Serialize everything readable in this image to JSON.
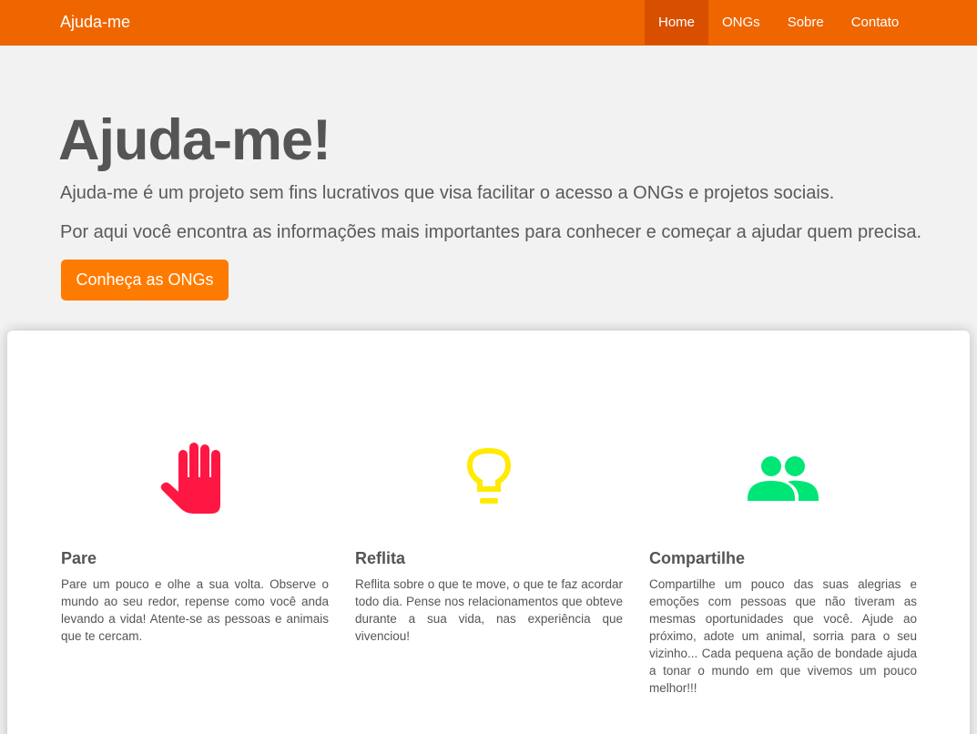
{
  "navbar": {
    "brand": "Ajuda-me",
    "items": [
      {
        "label": "Home",
        "active": true
      },
      {
        "label": "ONGs",
        "active": false
      },
      {
        "label": "Sobre",
        "active": false
      },
      {
        "label": "Contato",
        "active": false
      }
    ],
    "color": "#ef6600"
  },
  "hero": {
    "title": "Ajuda-me!",
    "lead1": "Ajuda-me é um projeto sem fins lucrativos que visa facilitar o acesso a ONGs e projetos sociais.",
    "lead2": "Por aqui você encontra as informações mais importantes para conhecer e começar a ajudar quem precisa.",
    "button_label": "Conheça as ONGs",
    "button_color": "#ff7b00"
  },
  "features": [
    {
      "icon": "hand-stop-icon",
      "icon_color": "#ff1744",
      "title": "Pare",
      "text": "Pare um pouco e olhe a sua volta. Observe o mundo ao seu redor, repense como você anda levando a vida! Atente-se as pessoas e animais que te cercam."
    },
    {
      "icon": "lightbulb-icon",
      "icon_color": "#ffea00",
      "title": "Reflita",
      "text": "Reflita sobre o que te move, o que te faz acordar todo dia. Pense nos relacionamentos que obteve durante a sua vida, nas experiência que vivenciou!"
    },
    {
      "icon": "people-icon",
      "icon_color": "#00e676",
      "title": "Compartilhe",
      "text": "Compartilhe um pouco das suas alegrias e emoções com pessoas que não tiveram as mesmas oportunidades que você. Ajude ao próximo, adote um animal, sorria para o seu vizinho... Cada pequena ação de bondade ajuda a tonar o mundo em que vivemos um pouco melhor!!!"
    }
  ]
}
